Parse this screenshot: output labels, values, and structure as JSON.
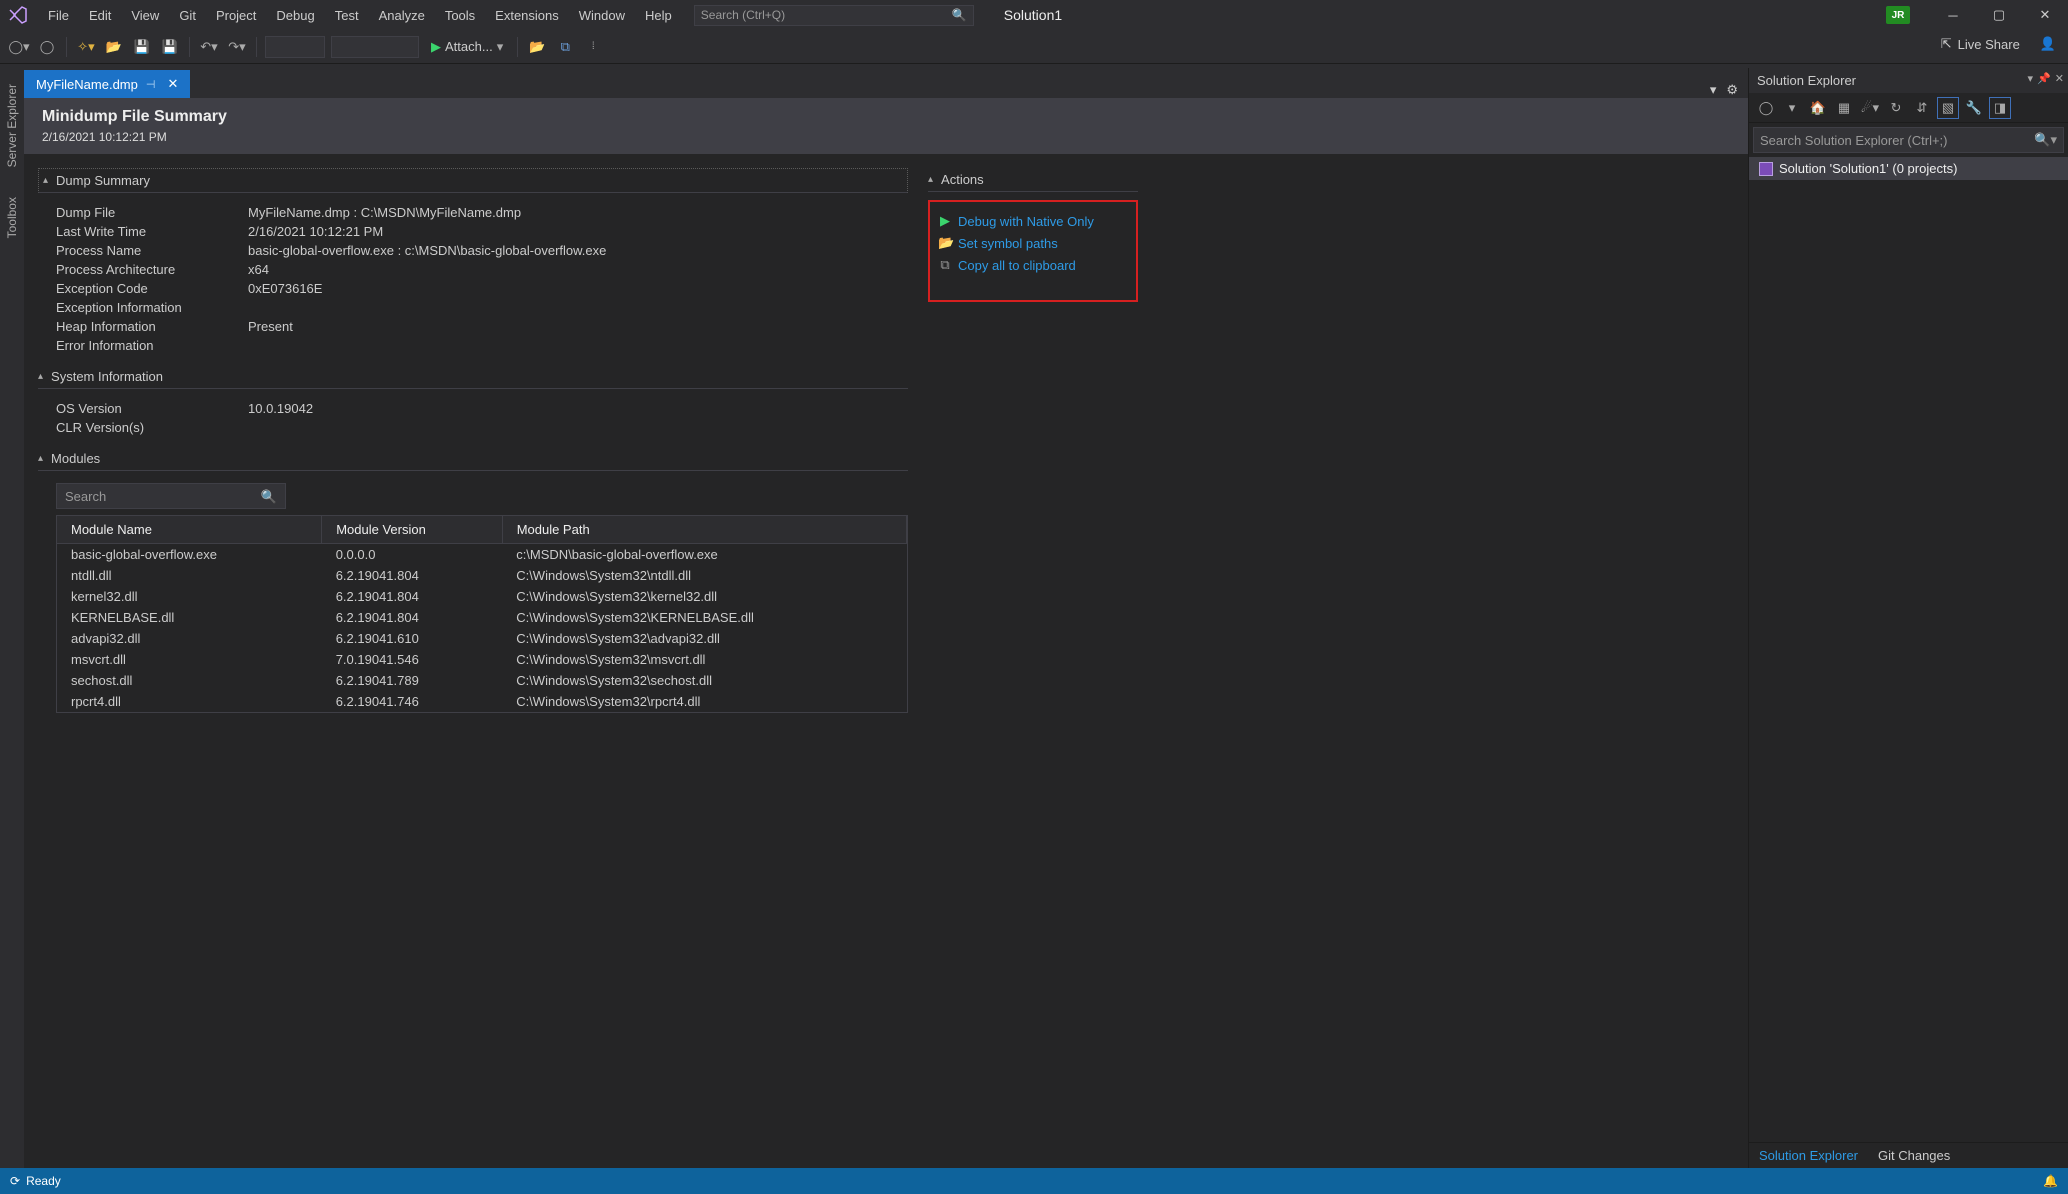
{
  "menu": [
    "File",
    "Edit",
    "View",
    "Git",
    "Project",
    "Debug",
    "Test",
    "Analyze",
    "Tools",
    "Extensions",
    "Window",
    "Help"
  ],
  "quick_search_placeholder": "Search (Ctrl+Q)",
  "solution_name": "Solution1",
  "user_initials": "JR",
  "toolbar": {
    "attach_label": "Attach...",
    "liveshare": "Live Share"
  },
  "left_rail": [
    "Server Explorer",
    "Toolbox"
  ],
  "doc_tab": {
    "name": "MyFileName.dmp"
  },
  "dump_header": {
    "title": "Minidump File Summary",
    "date": "2/16/2021 10:12:21 PM"
  },
  "sections": {
    "dump_summary": "Dump Summary",
    "system_info": "System Information",
    "modules": "Modules",
    "actions": "Actions"
  },
  "dump_info": [
    {
      "label": "Dump File",
      "value": "MyFileName.dmp : C:\\MSDN\\MyFileName.dmp"
    },
    {
      "label": "Last Write Time",
      "value": "2/16/2021 10:12:21 PM"
    },
    {
      "label": "Process Name",
      "value": "basic-global-overflow.exe : c:\\MSDN\\basic-global-overflow.exe"
    },
    {
      "label": "Process Architecture",
      "value": "x64"
    },
    {
      "label": "Exception Code",
      "value": "0xE073616E"
    },
    {
      "label": "Exception Information",
      "value": ""
    },
    {
      "label": "Heap Information",
      "value": "Present"
    },
    {
      "label": "Error Information",
      "value": ""
    }
  ],
  "sys_info": [
    {
      "label": "OS Version",
      "value": "10.0.19042"
    },
    {
      "label": "CLR Version(s)",
      "value": ""
    }
  ],
  "mod_search_placeholder": "Search",
  "mod_columns": [
    "Module Name",
    "Module Version",
    "Module Path"
  ],
  "modules": [
    {
      "name": "basic-global-overflow.exe",
      "ver": "0.0.0.0",
      "path": "c:\\MSDN\\basic-global-overflow.exe"
    },
    {
      "name": "ntdll.dll",
      "ver": "6.2.19041.804",
      "path": "C:\\Windows\\System32\\ntdll.dll"
    },
    {
      "name": "kernel32.dll",
      "ver": "6.2.19041.804",
      "path": "C:\\Windows\\System32\\kernel32.dll"
    },
    {
      "name": "KERNELBASE.dll",
      "ver": "6.2.19041.804",
      "path": "C:\\Windows\\System32\\KERNELBASE.dll"
    },
    {
      "name": "advapi32.dll",
      "ver": "6.2.19041.610",
      "path": "C:\\Windows\\System32\\advapi32.dll"
    },
    {
      "name": "msvcrt.dll",
      "ver": "7.0.19041.546",
      "path": "C:\\Windows\\System32\\msvcrt.dll"
    },
    {
      "name": "sechost.dll",
      "ver": "6.2.19041.789",
      "path": "C:\\Windows\\System32\\sechost.dll"
    },
    {
      "name": "rpcrt4.dll",
      "ver": "6.2.19041.746",
      "path": "C:\\Windows\\System32\\rpcrt4.dll"
    }
  ],
  "actions": [
    {
      "kind": "play",
      "label": "Debug with Native Only"
    },
    {
      "kind": "folder",
      "label": "Set symbol paths"
    },
    {
      "kind": "copy",
      "label": "Copy all to clipboard"
    }
  ],
  "solution_explorer": {
    "title": "Solution Explorer",
    "search_placeholder": "Search Solution Explorer (Ctrl+;)",
    "root": "Solution 'Solution1' (0 projects)"
  },
  "bottom_tabs": [
    "Solution Explorer",
    "Git Changes"
  ],
  "status": {
    "text": "Ready"
  }
}
